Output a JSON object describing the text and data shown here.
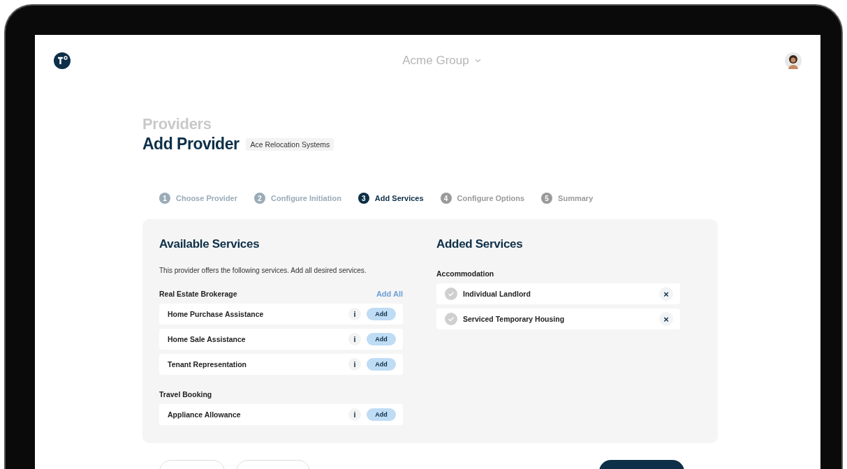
{
  "header": {
    "organization": "Acme Group"
  },
  "page": {
    "breadcrumb": "Providers",
    "title": "Add Provider",
    "provider_tag": "Ace Relocation Systems"
  },
  "steps": [
    {
      "number": "1",
      "label": "Choose Provider",
      "completed": true,
      "selected": false
    },
    {
      "number": "2",
      "label": "Configure Initiation",
      "completed": true,
      "selected": false
    },
    {
      "number": "3",
      "label": "Add Services",
      "completed": false,
      "selected": true
    },
    {
      "number": "4",
      "label": "Configure Options",
      "completed": false,
      "selected": false
    },
    {
      "number": "5",
      "label": "Summary",
      "completed": false,
      "selected": false
    }
  ],
  "available": {
    "title": "Available Services",
    "description": "This provider offers the following services. Add all desired services.",
    "groups": [
      {
        "name": "Real Estate Brokerage",
        "add_all": "Add All",
        "services": [
          {
            "name": "Home Purchase Assistance",
            "info": "i",
            "action": "Add"
          },
          {
            "name": "Home Sale Assistance",
            "info": "i",
            "action": "Add"
          },
          {
            "name": "Tenant Representation",
            "info": "i",
            "action": "Add"
          }
        ]
      },
      {
        "name": "Travel Booking",
        "services": [
          {
            "name": "Appliance Allowance",
            "info": "i",
            "action": "Add"
          }
        ]
      }
    ]
  },
  "added": {
    "title": "Added Services",
    "groups": [
      {
        "name": "Accommodation",
        "services": [
          {
            "name": "Individual Landlord",
            "remove": "×"
          },
          {
            "name": "Serviced Temporary Housing",
            "remove": "×"
          }
        ]
      }
    ]
  }
}
